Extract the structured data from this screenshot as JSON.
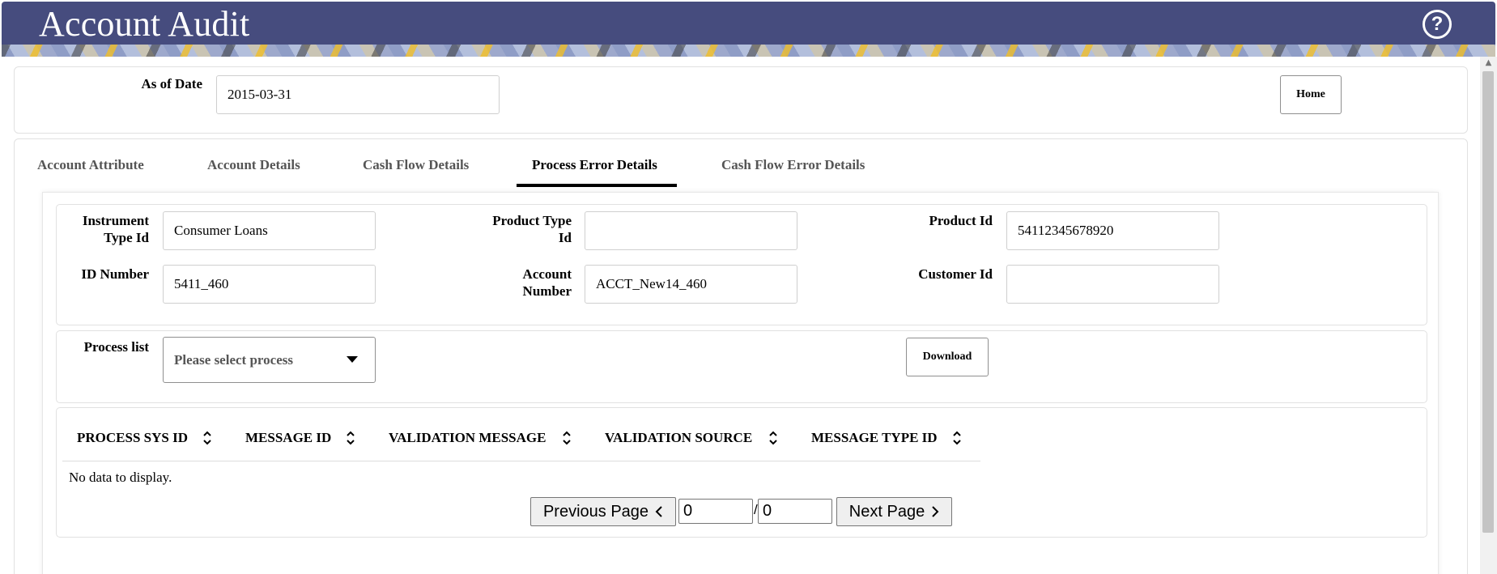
{
  "app": {
    "title": "Account Audit",
    "help_icon": "help-circle-icon"
  },
  "filters": {
    "as_of_date_label": "As of Date",
    "as_of_date_value": "2015-03-31",
    "home_label": "Home"
  },
  "tabs": [
    {
      "label": "Account Attribute",
      "active": false
    },
    {
      "label": "Account Details",
      "active": false
    },
    {
      "label": "Cash Flow Details",
      "active": false
    },
    {
      "label": "Process Error Details",
      "active": true
    },
    {
      "label": "Cash Flow Error Details",
      "active": false
    }
  ],
  "fields": {
    "instrument_type_id": {
      "label_line1": "Instrument",
      "label_line2": "Type Id",
      "value": "Consumer Loans"
    },
    "product_type_id": {
      "label_line1": "Product Type",
      "label_line2": "Id",
      "value": ""
    },
    "product_id": {
      "label": "Product Id",
      "value": "54112345678920"
    },
    "id_number": {
      "label": "ID Number",
      "value": "5411_460"
    },
    "account_number": {
      "label_line1": "Account",
      "label_line2": "Number",
      "value": "ACCT_New14_460"
    },
    "customer_id": {
      "label": "Customer Id",
      "value": ""
    }
  },
  "process": {
    "label": "Process list",
    "placeholder": "Please select process",
    "download_label": "Download"
  },
  "table": {
    "columns": [
      "PROCESS SYS ID",
      "MESSAGE ID",
      "VALIDATION MESSAGE",
      "VALIDATION SOURCE",
      "MESSAGE TYPE ID"
    ],
    "empty_text": "No data to display."
  },
  "pager": {
    "previous_label": "Previous Page",
    "next_label": "Next Page",
    "current_page": "0",
    "total_pages": "0",
    "separator": "/"
  },
  "colors": {
    "header_bg": "#464c7e",
    "active_tab_underline": "#000000"
  }
}
